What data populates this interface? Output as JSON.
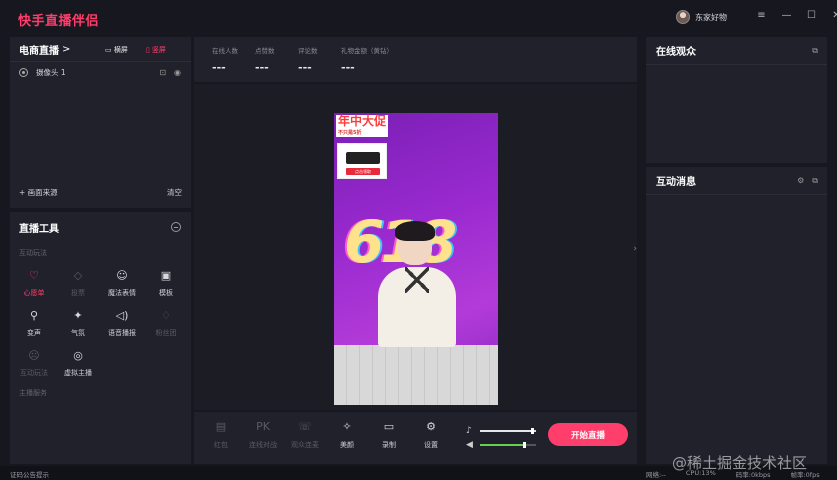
{
  "app": {
    "title": "快手直播伴侣"
  },
  "user": {
    "name": "东家好物"
  },
  "window_controls": [
    "≡",
    "—",
    "☐",
    "✕"
  ],
  "scene_panel": {
    "title": "电商直播",
    "title_arrow": ">",
    "mode_landscape": "横屏",
    "mode_portrait": "竖屏",
    "sources": [
      {
        "label": "摄像头 1"
      }
    ],
    "add_source": "+ 画面来源",
    "clear": "清空"
  },
  "tools_panel": {
    "title": "直播工具",
    "section_interactive": "互动玩法",
    "tools": [
      {
        "label": "心愿单",
        "icon": "gift-heart-icon",
        "state": "active"
      },
      {
        "label": "投票",
        "icon": "vote-icon",
        "state": "disabled"
      },
      {
        "label": "魔法表情",
        "icon": "magic-face-icon",
        "state": "normal"
      },
      {
        "label": "模板",
        "icon": "template-icon",
        "state": "normal"
      },
      {
        "label": "变声",
        "icon": "voice-change-icon",
        "state": "normal"
      },
      {
        "label": "气氛",
        "icon": "party-icon",
        "state": "normal"
      },
      {
        "label": "语音播报",
        "icon": "speaker-icon",
        "state": "normal"
      },
      {
        "label": "粉丝团",
        "icon": "fan-club-icon",
        "state": "disabled"
      },
      {
        "label": "互动玩法",
        "icon": "game-icon",
        "state": "disabled"
      },
      {
        "label": "虚拟主播",
        "icon": "virtual-anchor-icon",
        "state": "normal"
      }
    ],
    "section_anchor": "主播服务"
  },
  "stats": [
    {
      "label": "在线人数",
      "value": "---"
    },
    {
      "label": "点赞数",
      "value": "---"
    },
    {
      "label": "评论数",
      "value": "---"
    },
    {
      "label": "礼物金额（黄钻）",
      "value": "---"
    }
  ],
  "preview": {
    "promo_big": "年中大促",
    "promo_small": "不只是5折",
    "promo_card_button": "点击领取",
    "promo_number": "618"
  },
  "bottom_toolbar": {
    "tools": [
      {
        "label": "红包",
        "icon": "red-packet-icon",
        "state": "disabled"
      },
      {
        "label": "连线对战",
        "icon": "pk-icon",
        "state": "disabled"
      },
      {
        "label": "观众连麦",
        "icon": "mic-link-icon",
        "state": "disabled"
      },
      {
        "label": "美颜",
        "icon": "beauty-icon",
        "state": "normal"
      },
      {
        "label": "录制",
        "icon": "record-icon",
        "state": "normal"
      },
      {
        "label": "设置",
        "icon": "settings-icon",
        "state": "normal"
      }
    ],
    "mic_volume": 0.95,
    "speaker_volume": 0.8,
    "start_button": "开始直播"
  },
  "online_panel": {
    "title": "在线观众"
  },
  "messages_panel": {
    "title": "互动消息"
  },
  "statusbar": {
    "left": "证码公告提示",
    "network": "网络:--",
    "cpu": "CPU:13%",
    "bitrate": "码率:0kbps",
    "fps": "帧率:0fps"
  },
  "watermark": "@稀土掘金技术社区",
  "colors": {
    "accent": "#ff3e6c",
    "panel": "#21212b",
    "background": "#17171f",
    "volume_green": "#64d24c"
  }
}
